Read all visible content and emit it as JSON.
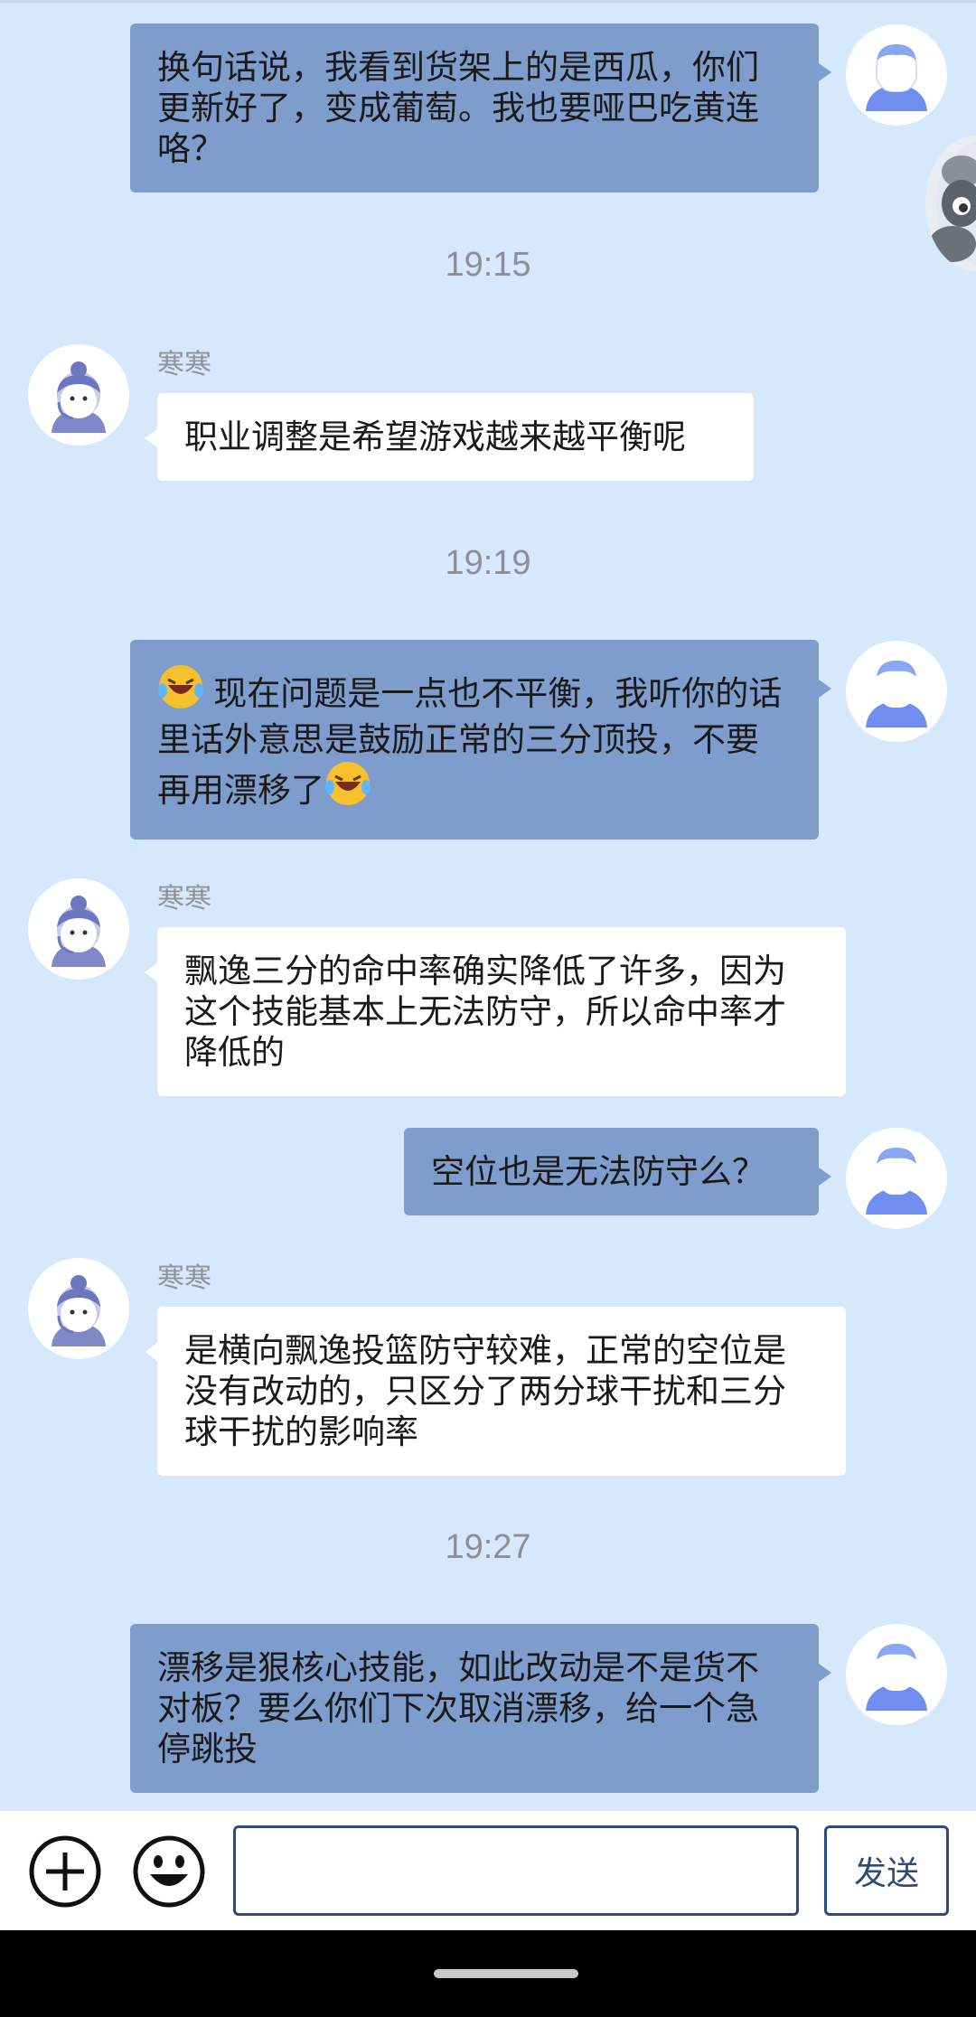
{
  "messages": [
    {
      "type": "me",
      "text": "换句话说，我看到货架上的是西瓜，你们更新好了，变成葡萄。我也要哑巴吃黄连咯？"
    },
    {
      "type": "time",
      "text": "19:15"
    },
    {
      "type": "them",
      "name": "寒寒",
      "text": "职业调整是希望游戏越来越平衡呢"
    },
    {
      "type": "time",
      "text": "19:19"
    },
    {
      "type": "me",
      "emoji": "laughing-crying",
      "text_part1": " 现在问题是一点也不平衡，我听你的话里话外意思是鼓励正常的三分顶投，不要再用漂移了"
    },
    {
      "type": "them",
      "name": "寒寒",
      "text": "飘逸三分的命中率确实降低了许多，因为这个技能基本上无法防守，所以命中率才降低的"
    },
    {
      "type": "me",
      "text": "空位也是无法防守么？"
    },
    {
      "type": "them",
      "name": "寒寒",
      "text": "是横向飘逸投篮防守较难，正常的空位是没有改动的，只区分了两分球干扰和三分球干扰的影响率"
    },
    {
      "type": "time",
      "text": "19:27"
    },
    {
      "type": "me",
      "text": "漂移是狠核心技能，如此改动是不是货不对板？要么你们下次取消漂移，给一个急停跳投"
    }
  ],
  "input": {
    "placeholder": "",
    "send_label": "发送"
  },
  "icons": {
    "plus": "add-circle-icon",
    "emoji": "smiley-icon",
    "user": "user-avatar-icon",
    "agent": "agent-avatar-icon",
    "mascot": "panda-mascot-icon"
  },
  "colors": {
    "background": "#d6e8fb",
    "my_bubble": "#7e9ccc",
    "their_bubble": "#ffffff",
    "accent": "#2c4a7c"
  }
}
